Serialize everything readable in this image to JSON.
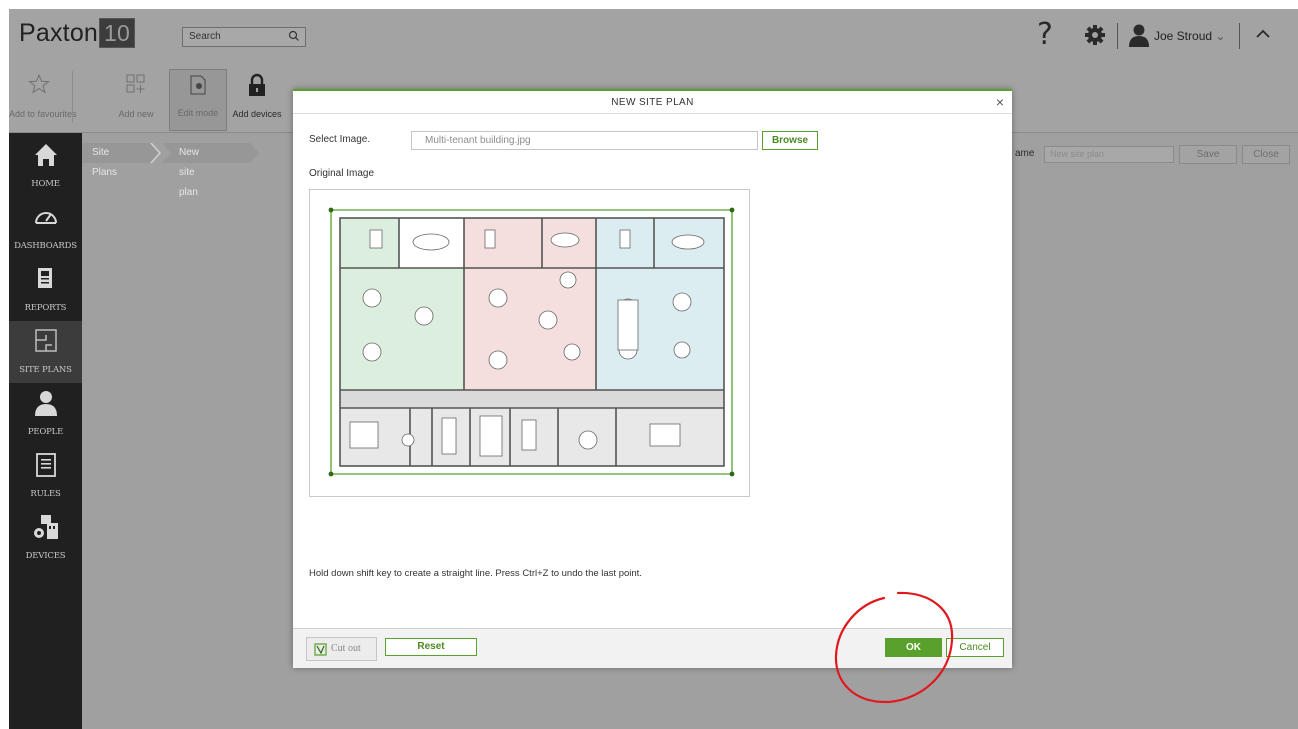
{
  "app": {
    "logo_text": "Paxton",
    "logo_version": "10",
    "search_placeholder": "Search",
    "help_glyph": "?",
    "user_name": "Joe Stroud",
    "user_chevron": "⌄"
  },
  "toolbar": {
    "items": [
      {
        "label": "Add to favourites",
        "icon": "star-icon"
      },
      {
        "label": "Add new",
        "icon": "grid-plus-icon"
      },
      {
        "label": "Edit mode",
        "icon": "edit-mode-icon"
      },
      {
        "label": "Add devices",
        "icon": "padlock-icon"
      }
    ]
  },
  "sidebar": {
    "items": [
      {
        "label": "HOME",
        "icon": "home-icon"
      },
      {
        "label": "DASHBOARDS",
        "icon": "dashboard-icon"
      },
      {
        "label": "REPORTS",
        "icon": "reports-icon"
      },
      {
        "label": "SITE PLANS",
        "icon": "site-plans-icon"
      },
      {
        "label": "PEOPLE",
        "icon": "person-icon"
      },
      {
        "label": "RULES",
        "icon": "rules-icon"
      },
      {
        "label": "DEVICES",
        "icon": "devices-icon"
      }
    ]
  },
  "breadcrumb": {
    "items": [
      "Site Plans",
      "New site plan"
    ]
  },
  "page_header": {
    "name_label": "ame",
    "name_placeholder": "New site plan",
    "save_label": "Save",
    "close_label": "Close"
  },
  "modal": {
    "title": "NEW SITE PLAN",
    "close_glyph": "×",
    "select_image_label": "Select Image.",
    "select_image_value": "Multi-tenant building.jpg",
    "browse_label": "Browse",
    "original_image_label": "Original Image",
    "hint": "Hold down shift key to create a straight line. Press Ctrl+Z to undo the last point.",
    "cutout_label": "Cut out",
    "reset_label": "Reset",
    "ok_label": "OK",
    "cancel_label": "Cancel"
  },
  "colors": {
    "accent_green": "#5aa02c",
    "sidebar_bg": "#202020",
    "annotation_red": "#e0181e",
    "zone_green": "#dceedd",
    "zone_pink": "#f4dede",
    "zone_blue": "#dcedf2",
    "zone_grey": "#e6e6e6"
  }
}
